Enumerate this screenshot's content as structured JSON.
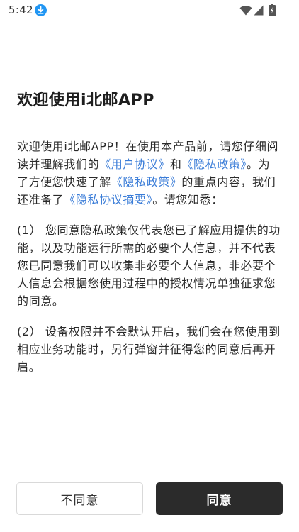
{
  "status_bar": {
    "time": "5:42",
    "icons": [
      "download-icon",
      "wifi-icon",
      "signal-icon",
      "battery-icon"
    ],
    "download_icon_color": "#2196f3"
  },
  "dialog": {
    "title": "欢迎使用i北邮APP",
    "para1": {
      "t1": "欢迎使用i北邮APP！在使用本产品前，请您仔细阅读并理解我们的",
      "link_user_agreement": "《用户协议》",
      "t2": "和",
      "link_privacy_policy": "《隐私政策》",
      "t3": "。为了方便您快速了解",
      "link_privacy_policy_2": "《隐私政策》",
      "t4": "的重点内容，我们还准备了",
      "link_privacy_summary": "《隐私协议摘要》",
      "t5": "。请您知悉："
    },
    "para2": "(1）  您同意隐私政策仅代表您已了解应用提供的功能，以及功能运行所需的必要个人信息，并不代表您已同意我们可以收集非必要个人信息，非必要个人信息会根据您使用过程中的授权情况单独征求您的同意。",
    "para3": "(2）  设备权限并不会默认开启，我们会在您使用到相应业务功能时，另行弹窗并征得您的同意后再开启。",
    "link_color": "#3b7dd8"
  },
  "buttons": {
    "disagree_label": "不同意",
    "agree_label": "同意",
    "agree_bg": "#2b2b2b"
  }
}
